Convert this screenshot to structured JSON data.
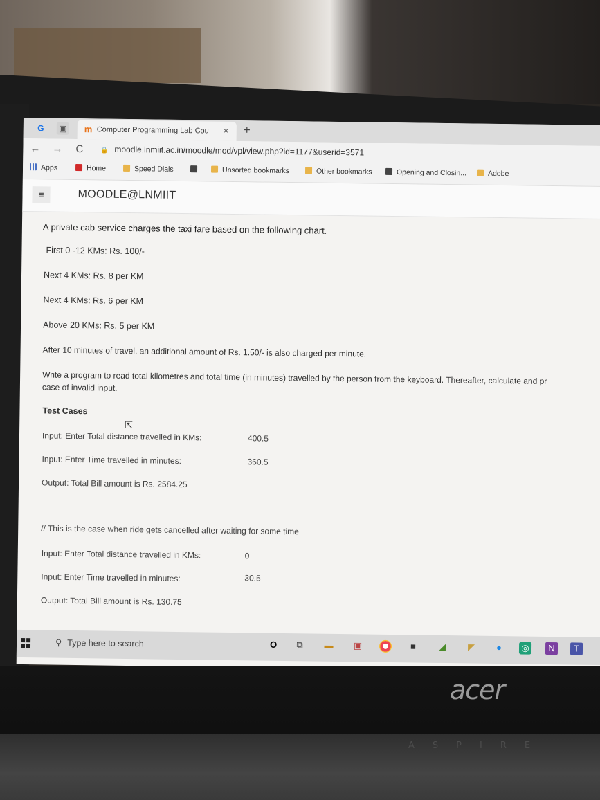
{
  "browser": {
    "tab_title": "Computer Programming Lab Cou",
    "tab_close": "×",
    "new_tab": "+",
    "url": "moodle.lnmiit.ac.in/moodle/mod/vpl/view.php?id=1177&userid=3571"
  },
  "bookmarks": [
    {
      "label": "Apps"
    },
    {
      "label": "Home"
    },
    {
      "label": "Speed Dials"
    },
    {
      "label": "Unsorted bookmarks"
    },
    {
      "label": "Other bookmarks"
    },
    {
      "label": "Opening and Closin..."
    },
    {
      "label": "Adobe"
    }
  ],
  "moodle": {
    "site_name": "MOODLE@LNMIIT"
  },
  "content": {
    "intro": "A private cab service charges the taxi fare based on the following chart.",
    "rules": [
      "First 0 -12 KMs: Rs. 100/-",
      "Next 4 KMs: Rs. 8 per KM",
      "Next 4 KMs: Rs. 6 per KM",
      "Above 20 KMs: Rs. 5 per KM"
    ],
    "extra_charge": "After 10 minutes of travel, an additional amount of Rs. 1.50/- is also charged per minute.",
    "task_line1": "Write a program to read total kilometres and total time (in minutes) travelled by the person from the keyboard. Thereafter, calculate and pr",
    "task_line2": "case of invalid input.",
    "test_cases_heading": "Test Cases",
    "case1": {
      "distance_label": "Input: Enter Total distance travelled in KMs:",
      "distance_value": "400.5",
      "time_label": "Input: Enter Time travelled in minutes:",
      "time_value": "360.5",
      "output": "Output: Total Bill amount is Rs. 2584.25"
    },
    "comment": "// This is the case when ride gets cancelled after waiting for some time",
    "case2": {
      "distance_label": "Input: Enter Total distance travelled in KMs:",
      "distance_value": "0",
      "time_label": "Input: Enter Time travelled in minutes:",
      "time_value": "30.5",
      "output": "Output: Total Bill amount is Rs. 130.75"
    }
  },
  "taskbar": {
    "search_placeholder": "Type here to search"
  },
  "laptop": {
    "brand": "acer",
    "series": "ASPIRE"
  }
}
